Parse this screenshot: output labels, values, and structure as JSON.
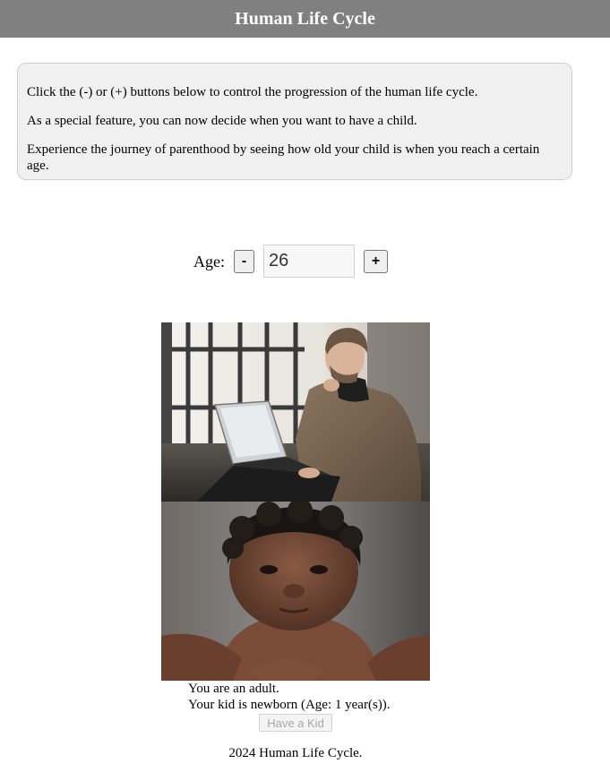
{
  "header": {
    "title": "Human Life Cycle"
  },
  "instructions": [
    "Click the (-) or (+) buttons below to control the progression of the human life cycle.",
    "As a special feature, you can now decide when you want to have a child.",
    "Experience the journey of parenthood by seeing how old your child is when you reach a certain age."
  ],
  "age_control": {
    "label": "Age:",
    "decrement_label": "-",
    "value": "26",
    "increment_label": "+"
  },
  "status": {
    "adult_text": "You are an adult.",
    "kid_text": "Your kid is newborn (Age: 1 year(s))."
  },
  "kid_button": {
    "label": "Have a Kid",
    "disabled": true
  },
  "footer": {
    "text": "2024 Human Life Cycle."
  }
}
